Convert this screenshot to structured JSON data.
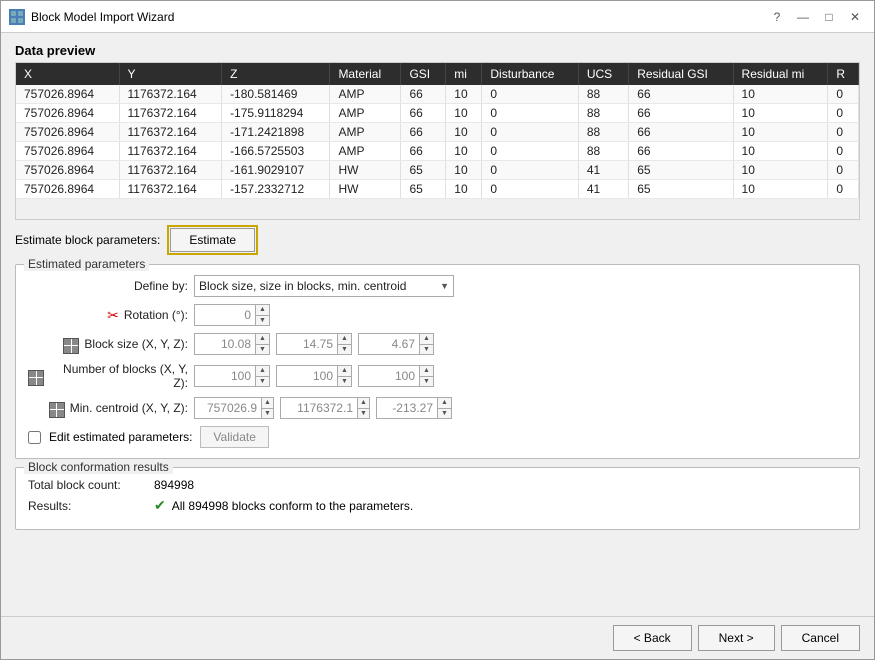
{
  "window": {
    "title": "Block Model Import Wizard",
    "help_icon": "?",
    "minimize": "—",
    "maximize": "□",
    "close": "✕"
  },
  "sections": {
    "data_preview": "Data preview",
    "estimate_parameters": "Estimate block parameters:",
    "estimated_parameters_group": "Estimated parameters",
    "block_conformation_group": "Block conformation results"
  },
  "table": {
    "columns": [
      "X",
      "Y",
      "Z",
      "Material",
      "GSI",
      "mi",
      "Disturbance",
      "UCS",
      "Residual GSI",
      "Residual mi",
      "R"
    ],
    "rows": [
      [
        "757026.8964",
        "1176372.164",
        "-180.581469",
        "AMP",
        "66",
        "10",
        "0",
        "88",
        "66",
        "10",
        "0"
      ],
      [
        "757026.8964",
        "1176372.164",
        "-175.9118294",
        "AMP",
        "66",
        "10",
        "0",
        "88",
        "66",
        "10",
        "0"
      ],
      [
        "757026.8964",
        "1176372.164",
        "-171.2421898",
        "AMP",
        "66",
        "10",
        "0",
        "88",
        "66",
        "10",
        "0"
      ],
      [
        "757026.8964",
        "1176372.164",
        "-166.5725503",
        "AMP",
        "66",
        "10",
        "0",
        "88",
        "66",
        "10",
        "0"
      ],
      [
        "757026.8964",
        "1176372.164",
        "-161.9029107",
        "HW",
        "65",
        "10",
        "0",
        "41",
        "65",
        "10",
        "0"
      ],
      [
        "757026.8964",
        "1176372.164",
        "-157.2332712",
        "HW",
        "65",
        "10",
        "0",
        "41",
        "65",
        "10",
        "0"
      ]
    ]
  },
  "estimate_btn": "Estimate",
  "define_by": {
    "label": "Define by:",
    "value": "Block size, size in blocks, min. centroid"
  },
  "rotation": {
    "label": "Rotation (°):",
    "value": "0"
  },
  "block_size": {
    "label": "Block size (X, Y, Z):",
    "v1": "10.08",
    "v2": "14.75",
    "v3": "4.67"
  },
  "num_blocks": {
    "label": "Number of blocks (X, Y, Z):",
    "v1": "100",
    "v2": "100",
    "v3": "100"
  },
  "min_centroid": {
    "label": "Min. centroid (X, Y, Z):",
    "v1": "757026.9",
    "v2": "1176372.1",
    "v3": "-213.27"
  },
  "edit_label": "Edit estimated parameters:",
  "validate_btn": "Validate",
  "total_block_count_label": "Total block count:",
  "total_block_count_value": "894998",
  "results_label": "Results:",
  "results_value": "All 894998 blocks conform to the parameters.",
  "footer": {
    "back": "< Back",
    "next": "Next >",
    "cancel": "Cancel"
  }
}
